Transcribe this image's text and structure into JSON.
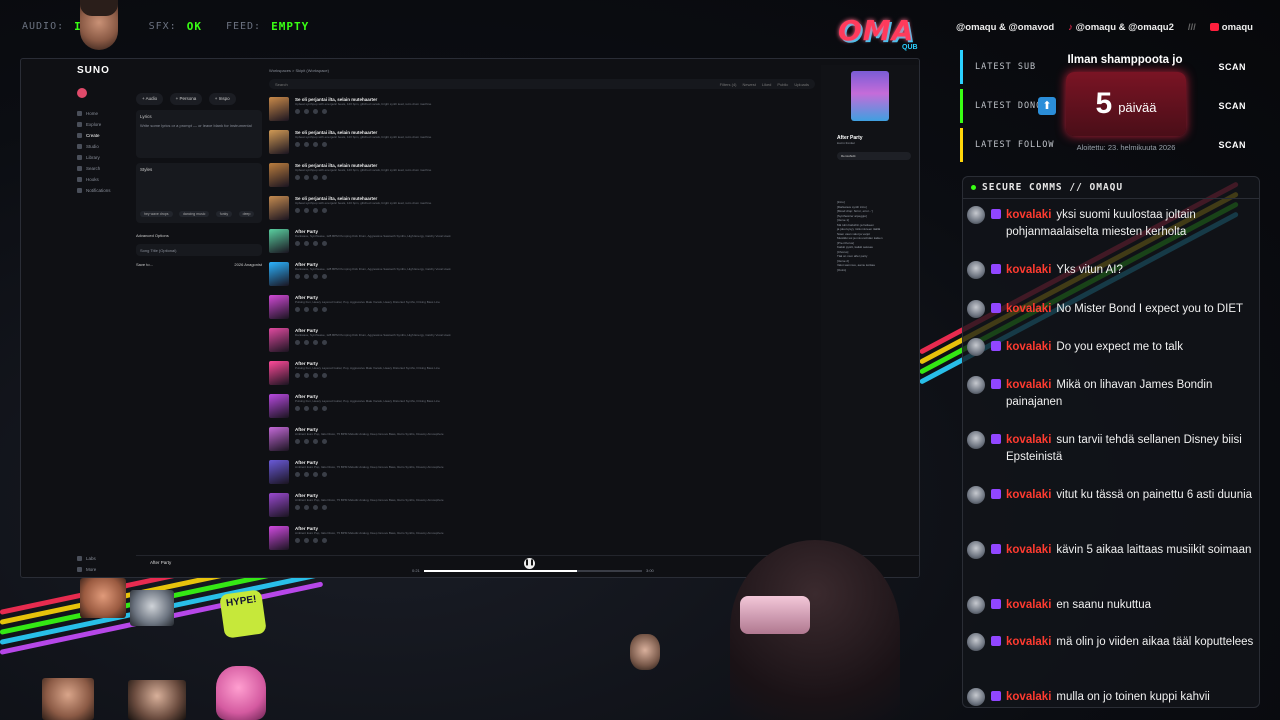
{
  "top_status": {
    "audio_label": "AUDIO:",
    "audio_value": "INIT",
    "sfx_label": "SFX:",
    "sfx_value": "OK",
    "feed_label": "FEED:",
    "feed_value": "EMPTY"
  },
  "logo": {
    "text": "OMA",
    "sub": "QUB"
  },
  "suno": {
    "brand": "SUNO",
    "buttons": [
      "+ Audio",
      "+ Persona",
      "+ Inspo"
    ],
    "lyrics_label": "Lyrics",
    "lyrics_placeholder": "Write some lyrics or a prompt — or leave blank for instrumental",
    "styles_label": "Styles",
    "style_chips": [
      "hey wave drops",
      "dancing music",
      "funky",
      "deep"
    ],
    "advanced_label": "Advanced Options",
    "song_title_placeholder": "Song Title (Optional)",
    "save_label": "Save to...",
    "workspace_label": "2026 Anagonist",
    "nav": [
      "Home",
      "Explore",
      "Create",
      "Studio",
      "Library",
      "Search",
      "Hooks",
      "Notifications"
    ],
    "nav_extra": [
      "Labs",
      "More"
    ],
    "search_placeholder": "Search",
    "filters": [
      "Filters (4)",
      "Newest",
      "Liked",
      "Public",
      "Uploads"
    ],
    "breadcrumb": "Workspaces > Skipit (Workspace)"
  },
  "songs": [
    {
      "title": "Se oli perjantai ilta, selain mutehaarter",
      "desc": "Upbeat synthpop with energetic beats, 120 bpm, glitched vocals, bright synth lead, retro drum machine"
    },
    {
      "title": "Se oli perjantai ilta, selain mutehaarter",
      "desc": "Upbeat synthpop with energetic beats, 120 bpm, glitched vocals, bright synth lead, retro drum machine"
    },
    {
      "title": "Se oli perjantai ilta, selain mutehaarter",
      "desc": "Upbeat synthpop with energetic beats, 120 bpm, glitched vocals, bright synth lead, retro drum machine"
    },
    {
      "title": "Se oli perjantai ilta, selain mutehaarter",
      "desc": "Upbeat synthpop with energetic beats, 120 bpm, glitched vocals, bright synth lead, retro drum machine"
    },
    {
      "title": "After Party",
      "desc": "Darkwave, Synthwave, 128 BPM Pumping Kick Drum, Aggressive Sawtooth Synths, High Energy, Catchy Vocal Hook"
    },
    {
      "title": "After Party",
      "desc": "Darkwave, Synthwave, 128 BPM Pumping Kick Drum, Aggressive Sawtooth Synths, High Energy, Catchy Vocal Hook"
    },
    {
      "title": "After Party",
      "desc": "Pulsing Fun, Heavy Layered Guitar, Pop, Aggressive Male Vocals, Heavy Distorted Synths, Driving Bass Line"
    },
    {
      "title": "After Party",
      "desc": "Darkwave, Synthwave, 128 BPM Pumping Kick Drum, Aggressive Sawtooth Synths, High Energy, Catchy Vocal Hook"
    },
    {
      "title": "After Party",
      "desc": "Pulsing Fun, Heavy Layered Guitar, Pop, Aggressive Male Vocals, Heavy Distorted Synths, Driving Bass Line"
    },
    {
      "title": "After Party",
      "desc": "Pulsing Fun, Heavy Layered Guitar, Pop, Aggressive Male Vocals, Heavy Distorted Synths, Driving Bass Line"
    },
    {
      "title": "After Party",
      "desc": "Ambient Euro Pop, Italo Disco, 75 BPM Melodic Analog, Deep Groove Bass, Retro Synths, Dreamy Atmosphere"
    },
    {
      "title": "After Party",
      "desc": "Ambient Euro Pop, Italo Disco, 75 BPM Melodic Analog, Deep Groove Bass, Retro Synths, Dreamy Atmosphere"
    },
    {
      "title": "After Party",
      "desc": "Ambient Euro Pop, Italo Disco, 75 BPM Melodic Analog, Deep Groove Bass, Retro Synths, Dreamy Atmosphere"
    },
    {
      "title": "After Party",
      "desc": "Ambient Euro Pop, Italo Disco, 75 BPM Melodic Analog, Deep Groove Bass, Retro Synths, Dreamy Atmosphere"
    }
  ],
  "detail": {
    "title": "After Party",
    "author": "lost in frontier",
    "remix_label": "Remix/Edit",
    "lyrics": [
      "[Intro]",
      "[Darkwave synth intro]",
      "[Mood drop: 'Error, error...']",
      "[Synthesizer arpeggio]",
      "[Verse 1]",
      "Mä tulin bailuihin ja hetkeen",
      "ja joku kysyy mitä mä teen täällä",
      "Näen vaan valot ja varjot",
      "Musiikki soi ja mä unohdan kaiken",
      "[Pre-Chorus]",
      "Kaikki pyörii, kaikki sekoaa",
      "[Chorus]",
      "Tää on mun after party",
      "[Verse 2]",
      "Valot sammuu, aamu koittaa",
      "[Outro]"
    ]
  },
  "player": {
    "title": "After Party",
    "time_current": "0:21",
    "time_total": "3:00",
    "progress": 0.7
  },
  "ticker": {
    "item1": "@omaqu & @omavod",
    "item2": "@omaqu & @omaqu2",
    "sep": "///",
    "item3": "omaqu"
  },
  "stats": [
    {
      "label": "LATEST SUB",
      "value": "SCAN",
      "color": "#2bd1ff"
    },
    {
      "label": "LATEST DONO",
      "value": "SCAN",
      "color": "#39ff14"
    },
    {
      "label": "LATEST FOLLOW",
      "value": "SCAN",
      "color": "#ffd60a"
    }
  ],
  "counter": {
    "headline": "Ilman shamppoota jo",
    "number": "5",
    "unit": "päivää",
    "started": "Aloitettu: 23. helmikuuta 2026"
  },
  "chat": {
    "header": "SECURE COMMS // OMAQU",
    "messages": [
      {
        "nick": "kovalaki",
        "text": "yksi suomi kuulostaa joltain pohjanmaalaiselta miesten kerholta"
      },
      {
        "nick": "kovalaki",
        "text": "Yks vitun AI?"
      },
      {
        "nick": "kovalaki",
        "text": "No Mister Bond I expect you to DIET"
      },
      {
        "nick": "kovalaki",
        "text": "Do you expect me to talk"
      },
      {
        "nick": "kovalaki",
        "text": "Mikä on lihavan James Bondin painajanen"
      },
      {
        "nick": "kovalaki",
        "text": "sun tarvii tehdä sellanen Disney biisi Epsteinistä"
      },
      {
        "nick": "kovalaki",
        "text": "vitut ku tässä on painettu 6 asti duunia"
      },
      {
        "nick": "kovalaki",
        "text": "kävin 5 aikaa laittaas musiikit soimaan"
      },
      {
        "nick": "kovalaki",
        "text": "en saanu nukuttua"
      },
      {
        "nick": "kovalaki",
        "text": "mä olin jo viiden aikaa tääl koputtelees"
      },
      {
        "nick": "kovalaki",
        "text": "mulla on jo toinen kuppi kahvii"
      }
    ]
  },
  "hype_label": "HYPE!"
}
